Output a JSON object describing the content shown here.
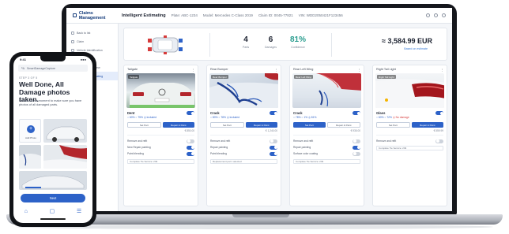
{
  "laptop": {
    "brand": "Claims Management",
    "page_title": "Intelligent Estimating",
    "breadcrumbs": [
      "Plate: ABC-1234",
      "Model: Mercedes C-Class 2019",
      "Claim ID: 0045-77821",
      "VIN: WDD2050421F123456"
    ],
    "sidebar": [
      {
        "label": "Back to list"
      },
      {
        "label": "Claim"
      },
      {
        "label": "Vehicle Identification"
      },
      {
        "label": "Upload Photos"
      },
      {
        "label": "Damage Overview"
      },
      {
        "label": "Intelligent Estimating"
      },
      {
        "label": "Summary"
      }
    ],
    "summary": {
      "stats": [
        {
          "value": "4",
          "label": "Parts"
        },
        {
          "value": "6",
          "label": "Damages"
        },
        {
          "value": "81%",
          "label": "Confidence"
        }
      ],
      "total": "≈ 3,584.99 EUR",
      "total_sub": "Based on estimate"
    },
    "cards": [
      {
        "title": "Tailgate",
        "photo_tag": "Tailgate",
        "damage": "Dent",
        "meta": "○ 60%  ○ 75%  ◎ included",
        "warn": "",
        "btn_left": "Set Part",
        "btn_right": "Repair & Paint",
        "price": "€ 850.00",
        "options": [
          {
            "label": "Remove and refit",
            "on": false
          },
          {
            "label": "New Repair painting",
            "on": true
          },
          {
            "label": "Paint blending",
            "on": true
          }
        ],
        "select": "Complete Tie Service: 249"
      },
      {
        "title": "Rear Bumper",
        "photo_tag": "Rear Bumper",
        "damage": "Crack",
        "meta": "○ 80%  ○ 78%  ◎ included",
        "warn": "",
        "btn_left": "Set Part",
        "btn_right": "Repair & Paint",
        "price": "€ 1,240.00",
        "options": [
          {
            "label": "Remove and refit",
            "on": false
          },
          {
            "label": "Repair painting",
            "on": true
          },
          {
            "label": "Paint blending",
            "on": true
          }
        ],
        "select": "Replacement part: selected"
      },
      {
        "title": "Rear Left Wing",
        "photo_tag": "Rear Left Wing",
        "damage": "Crack",
        "meta": "○ 78%  ○ 1%  ◎ 81%",
        "warn": "",
        "btn_left": "Set Part",
        "btn_right": "Repair & Paint",
        "price": "€ 935.00",
        "options": [
          {
            "label": "Remove and refit",
            "on": false
          },
          {
            "label": "Repair painting",
            "on": true
          },
          {
            "label": "Surface color coating",
            "on": false
          }
        ],
        "select": "Complete Tie Service: 249"
      },
      {
        "title": "Right Tail Light",
        "photo_tag": "Right Tail Light",
        "damage": "Glass",
        "meta": "○ 60%  ○ 72%",
        "warn": "◎ No damage",
        "btn_left": "Set Part",
        "btn_right": "Repair & Paint",
        "price": "€ 559.99",
        "options": [
          {
            "label": "Remove and refit",
            "on": false
          }
        ],
        "select": "Complete Tie Service: 249"
      }
    ]
  },
  "phone": {
    "time": "9:41",
    "signal": "●●●",
    "url": "SmartDamageCapture",
    "step": "STEP 3 OF 5",
    "title": "Well Done, All Damage photos taken.",
    "description": "Please take a moment to make sure you have photos of all damaged parts.",
    "add_photo": "Add Photo",
    "next_label": "Next",
    "nav": [
      "⌂",
      "▢",
      "☰"
    ]
  },
  "colors": {
    "accent": "#2d62c8",
    "dark": "#15171c",
    "success": "#2a9d8f",
    "warning": "#d63a3a"
  }
}
